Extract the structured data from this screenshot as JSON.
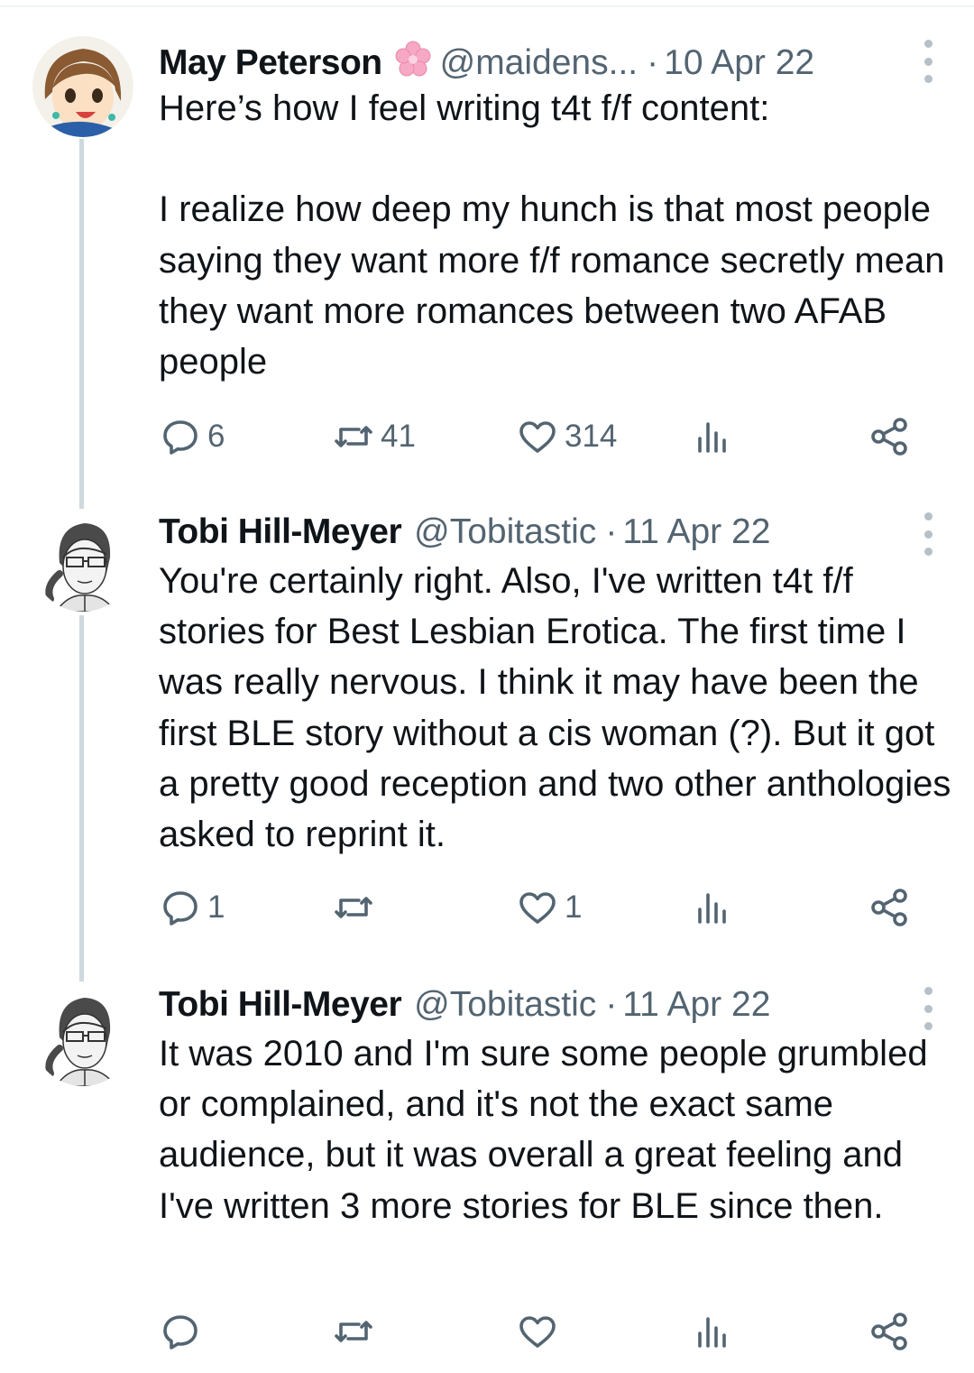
{
  "tweets": [
    {
      "author_name": "May Peterson",
      "badge": "cherry-blossom-emoji",
      "handle": "@maidens...",
      "separator": "·",
      "date": "10 Apr 22",
      "text": "Here’s how I feel writing t4t f/f content:\n\nI realize how deep my hunch is that most people saying they want more f/f romance secretly mean they want more romances between two AFAB people",
      "replies": "6",
      "retweets": "41",
      "likes": "314",
      "views": ""
    },
    {
      "author_name": "Tobi Hill-Meyer",
      "handle": "@Tobitastic",
      "separator": "·",
      "date": "11 Apr 22",
      "text": "You're certainly right. Also, I've written t4t f/f stories for Best Lesbian Erotica. The first time I was really nervous. I think it may have been the first BLE story without a cis woman (?). But it got a pretty good reception and two other anthologies asked to reprint it.",
      "replies": "1",
      "retweets": "",
      "likes": "1",
      "views": ""
    },
    {
      "author_name": "Tobi Hill-Meyer",
      "handle": "@Tobitastic",
      "separator": "·",
      "date": "11 Apr 22",
      "text": "It was 2010 and I'm sure some people grumbled or complained, and it's not the exact same audience, but it was overall a great feeling and I've written 3 more stories for BLE since then.",
      "replies": "",
      "retweets": "",
      "likes": "",
      "views": ""
    }
  ],
  "colors": {
    "text": "#0f1419",
    "secondary": "#536471",
    "thread_line": "#cfd9de",
    "badge_pink": "#f7a8c4"
  },
  "icons": [
    "reply-icon",
    "retweet-icon",
    "like-icon",
    "views-icon",
    "share-icon",
    "more-icon"
  ]
}
